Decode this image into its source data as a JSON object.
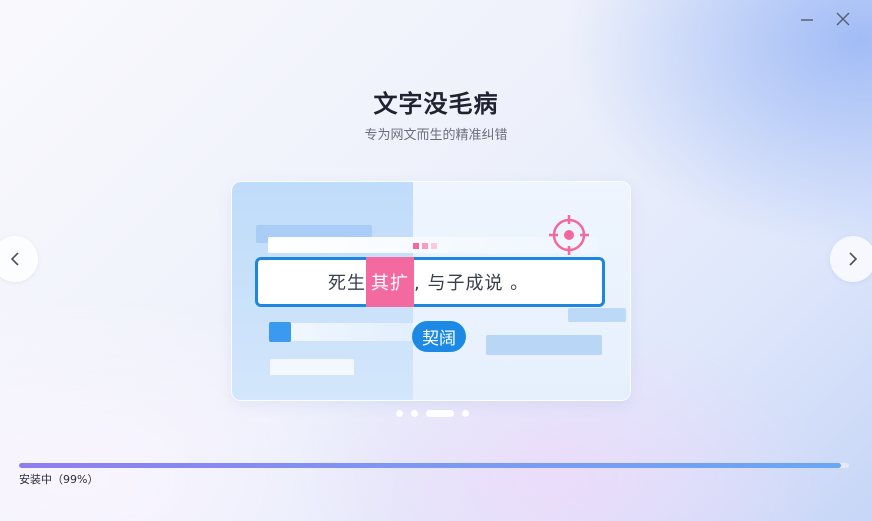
{
  "window": {
    "min_icon": "minimize-icon",
    "close_icon": "close-icon"
  },
  "header": {
    "title": "文字没毛病",
    "subtitle": "专为网文而生的精准纠错"
  },
  "carousel": {
    "prev_icon": "chevron-left-icon",
    "next_icon": "chevron-right-icon",
    "slide": {
      "sentence_before": "死生",
      "highlight": "其扩",
      "sentence_after": ", 与子成说 。",
      "suggestion": "契阔",
      "target_icon": "crosshair-target-icon"
    },
    "page_count": 4,
    "active_page": 3
  },
  "install": {
    "status_text": "安装中（99%）",
    "progress": 0.99
  },
  "colors": {
    "accent": "#1f86e0",
    "highlight": "#f36aa0",
    "progress_start": "#8e7df0",
    "progress_end": "#6aa6f6"
  }
}
